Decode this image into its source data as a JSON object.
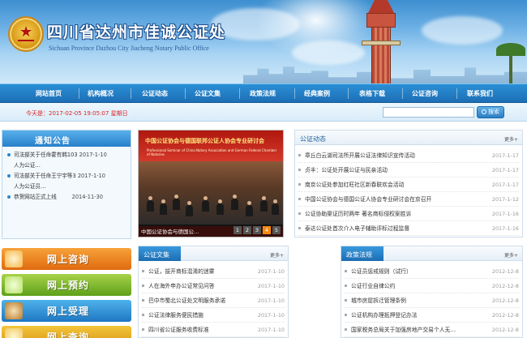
{
  "header": {
    "title": "四川省达州市佳诚公证处",
    "subtitle": "Sichuan Province Dazhou City Jiacheng Notary Public Office"
  },
  "nav": {
    "items": [
      "网站首页",
      "机构概况",
      "公证动态",
      "公证文集",
      "政策法规",
      "经典案例",
      "表格下载",
      "公证咨询",
      "联系我们"
    ]
  },
  "infobar": {
    "date": "今天是：2017-02-05 19:05:07 星期日",
    "search_value": "",
    "search_label": "搜索"
  },
  "notice": {
    "title": "通知公告",
    "items": [
      {
        "text": "司法部关于任命霍有韩103",
        "date": "2017-1-10",
        "cont": "人为公证…"
      },
      {
        "text": "司法部关于任命王宁宇等3",
        "date": "2017-1-10",
        "cont": "人为公证员…"
      },
      {
        "text": "恭贺网站正式上线",
        "date": "2014-11-30",
        "cont": ""
      }
    ]
  },
  "slide": {
    "banner_cn": "中国公证协会与德国联邦公证人协会专业研讨会",
    "banner_en": "Professional Seminar of China Notary Association and German Federal Chamber of Notaries",
    "caption": "中国公证协会与德国公…",
    "pages": [
      "1",
      "2",
      "3",
      "4",
      "5"
    ]
  },
  "news": {
    "title": "公证动态",
    "more": "更多+",
    "items": [
      {
        "text": "章丘白云湖司法所开展公证法律知识宣传活动",
        "date": "2017-1-17"
      },
      {
        "text": "贞丰：公证处开展公证与民亲活动",
        "date": "2017-1-17"
      },
      {
        "text": "南京公证处参加红旺社区新春联欢会活动",
        "date": "2017-1-17"
      },
      {
        "text": "中国公证协会与德国公证人协会专业研讨会在京召开",
        "date": "2017-1-12"
      },
      {
        "text": "公证协助渠证历时两年 著名商标侵权案胜诉",
        "date": "2017-1-16"
      },
      {
        "text": "泰达公证处首次介入电子辅助评标过程监督",
        "date": "2017-1-16"
      }
    ]
  },
  "wenji": {
    "title": "公证文集",
    "more": "更多+",
    "items": [
      {
        "text": "公证，拔开商标混淆的迷雾",
        "date": "2017-1-10"
      },
      {
        "text": "人在海外申办公证常见问答",
        "date": "2017-1-10"
      },
      {
        "text": "巴中市蜀北公证处文明服务承诺",
        "date": "2017-1-10"
      },
      {
        "text": "公证法律服务便民措施",
        "date": "2017-1-10"
      },
      {
        "text": "四川省公证服务收费标准",
        "date": "2017-1-10"
      }
    ]
  },
  "fagui": {
    "title": "政策法规",
    "more": "更多+",
    "items": [
      {
        "text": "公证员惩戒规则（试行）",
        "date": "2012-12-8"
      },
      {
        "text": "公证行业自律公约",
        "date": "2012-12-8"
      },
      {
        "text": "城市房屋拆迁管理条例",
        "date": "2012-12-8"
      },
      {
        "text": "公证机构办理抵押登记办法",
        "date": "2012-12-8"
      },
      {
        "text": "国家税务总局关于加强房地产交易个人无…",
        "date": "2012-12-8"
      }
    ]
  },
  "services": [
    {
      "label": "网上咨询"
    },
    {
      "label": "网上预约"
    },
    {
      "label": "网上受理"
    },
    {
      "label": "网上查询"
    }
  ],
  "colors": {
    "nav_bg": "#1d6fb5",
    "date_red": "#dd2222",
    "title_blue": "#1d5f9c"
  }
}
